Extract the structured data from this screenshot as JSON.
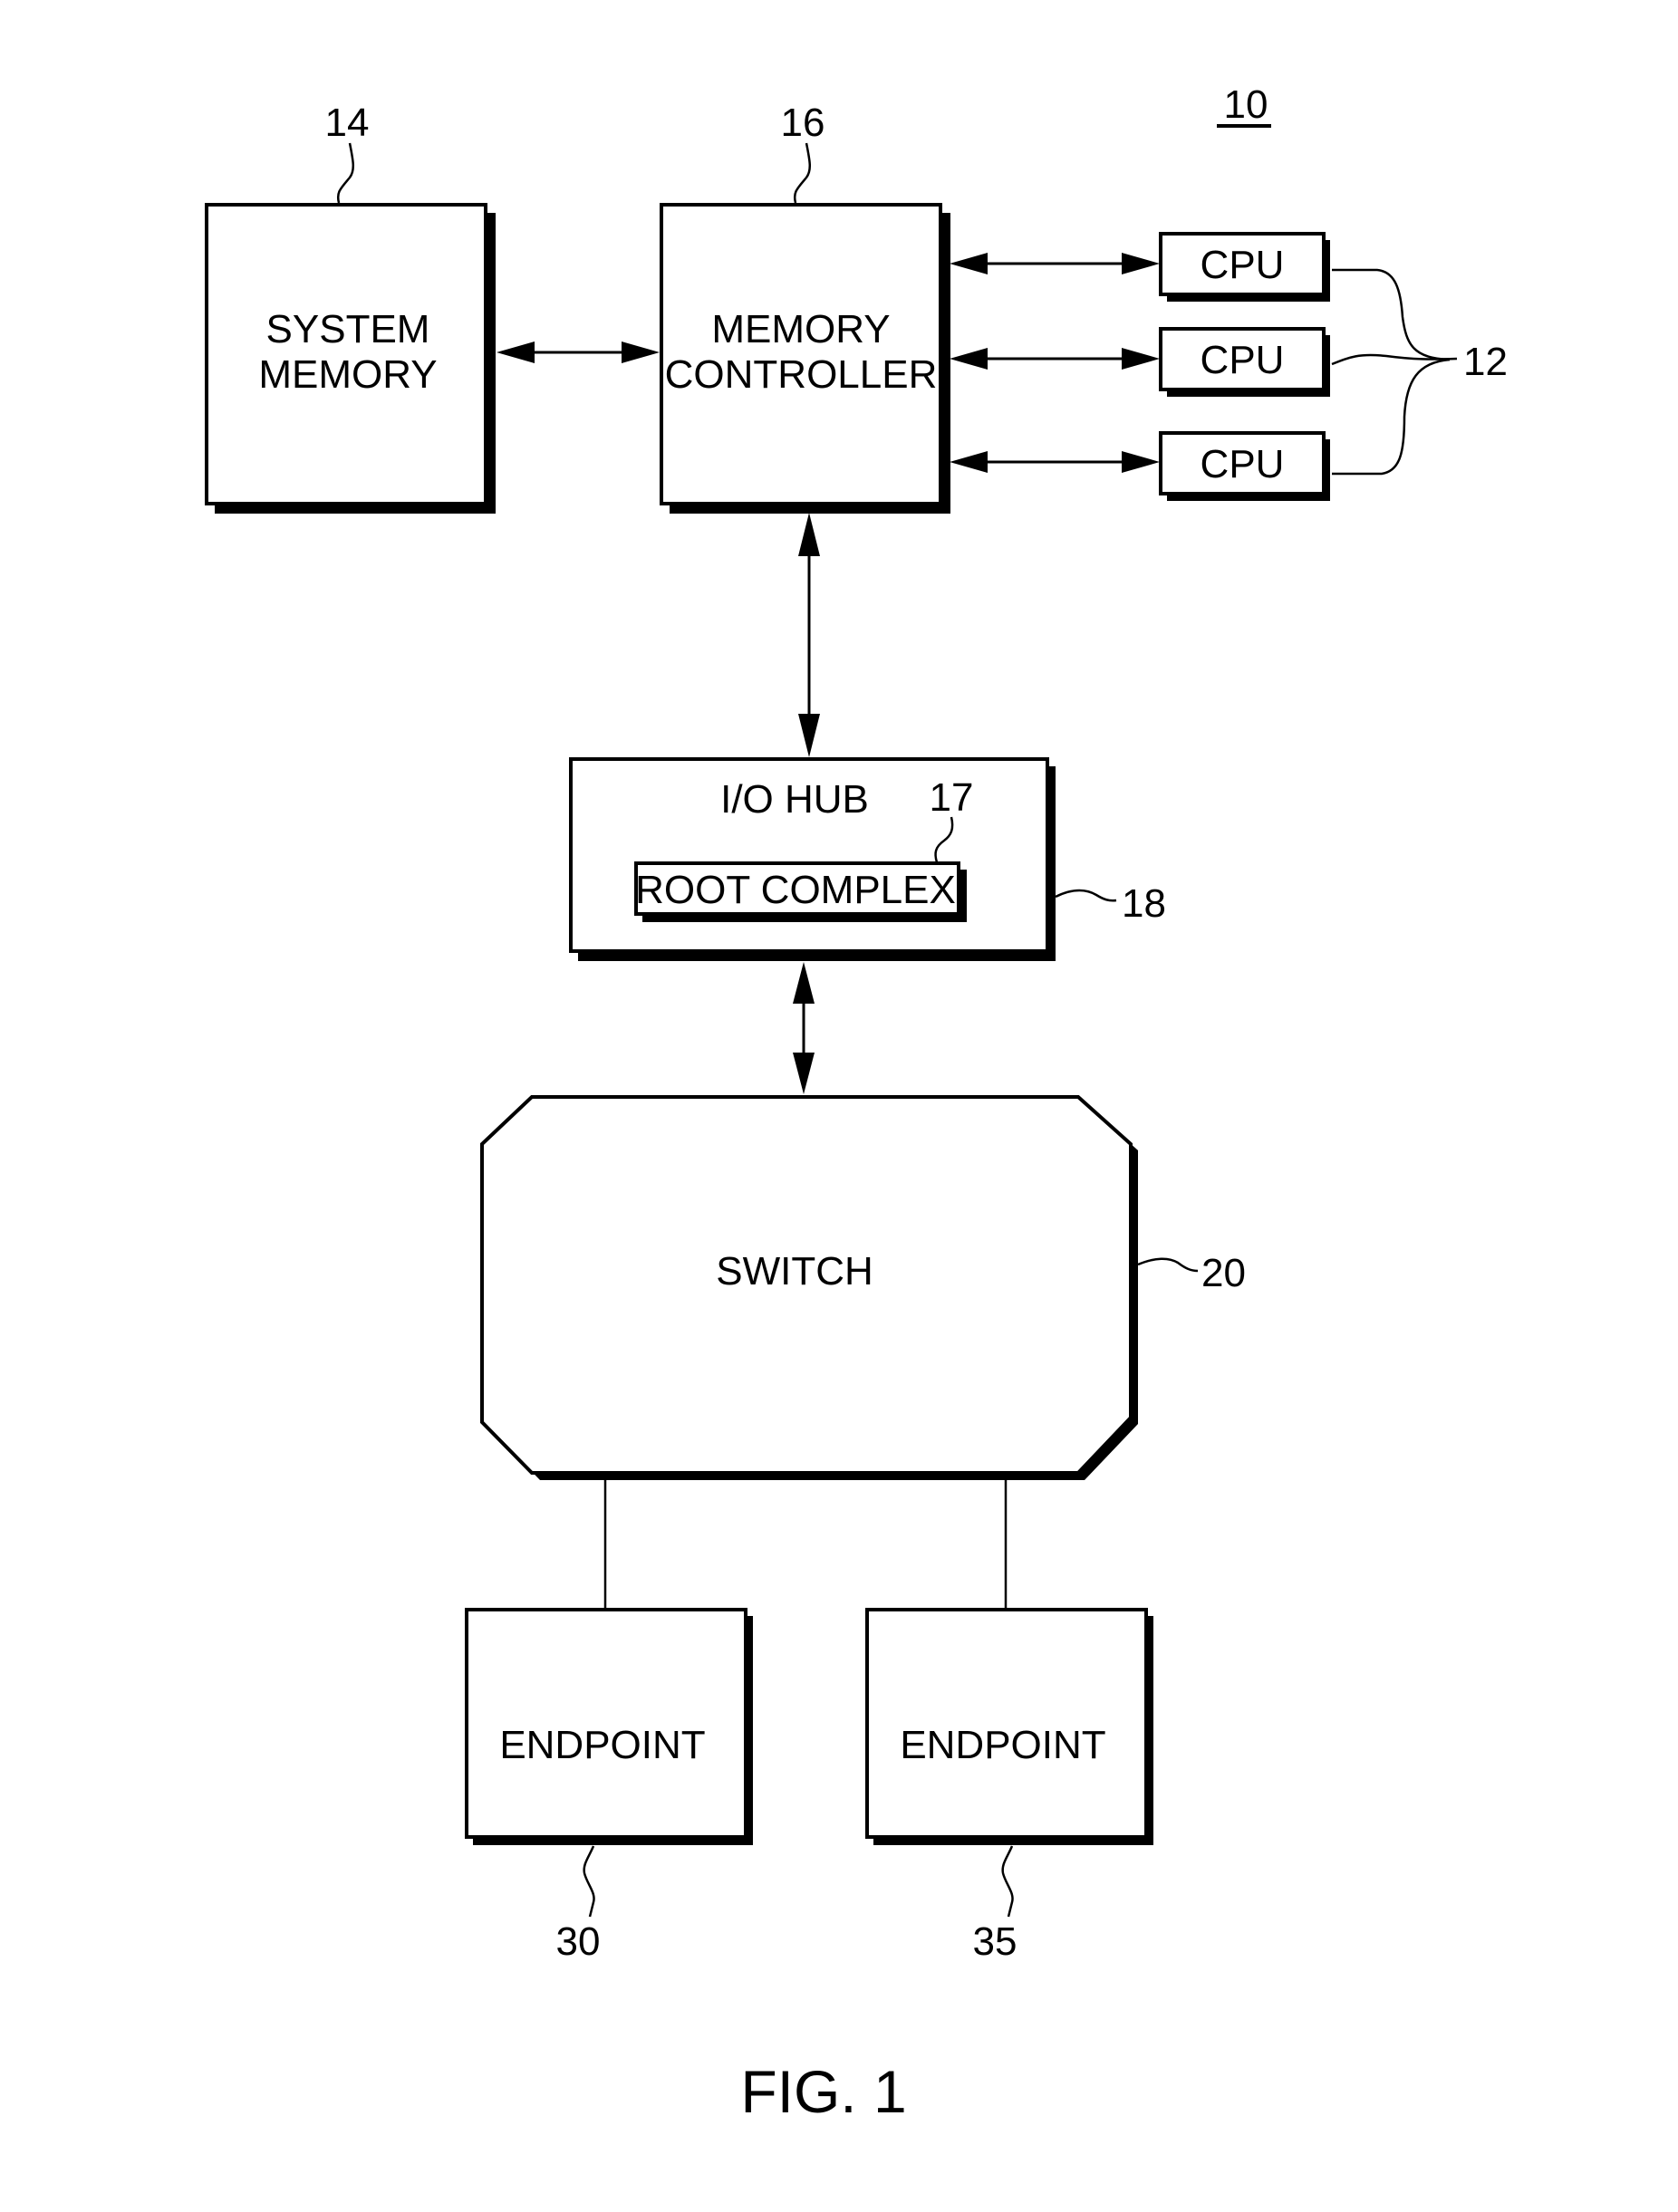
{
  "figure": {
    "caption": "FIG. 1",
    "system_ref": "10"
  },
  "blocks": {
    "system_memory": {
      "line1": "SYSTEM",
      "line2": "MEMORY",
      "ref": "14"
    },
    "memory_controller": {
      "line1": "MEMORY",
      "line2": "CONTROLLER",
      "ref": "16"
    },
    "cpus": {
      "labels": [
        "CPU",
        "CPU",
        "CPU"
      ],
      "ref": "12"
    },
    "io_hub": {
      "label": "I/O HUB",
      "ref": "18"
    },
    "root_complex": {
      "label": "ROOT COMPLEX",
      "ref": "17"
    },
    "switch": {
      "label": "SWITCH",
      "ref": "20"
    },
    "endpoint_a": {
      "label": "ENDPOINT",
      "ref": "30"
    },
    "endpoint_b": {
      "label": "ENDPOINT",
      "ref": "35"
    }
  },
  "connections": [
    {
      "from": "system_memory",
      "to": "memory_controller",
      "type": "bidirectional-arrow"
    },
    {
      "from": "memory_controller",
      "to": "cpu_1",
      "type": "bidirectional-arrow"
    },
    {
      "from": "memory_controller",
      "to": "cpu_2",
      "type": "bidirectional-arrow"
    },
    {
      "from": "memory_controller",
      "to": "cpu_3",
      "type": "bidirectional-arrow"
    },
    {
      "from": "memory_controller",
      "to": "io_hub",
      "type": "bidirectional-arrow"
    },
    {
      "from": "io_hub",
      "to": "switch",
      "type": "bidirectional-arrow"
    },
    {
      "from": "switch",
      "to": "endpoint_a",
      "type": "line"
    },
    {
      "from": "switch",
      "to": "endpoint_b",
      "type": "line"
    }
  ]
}
